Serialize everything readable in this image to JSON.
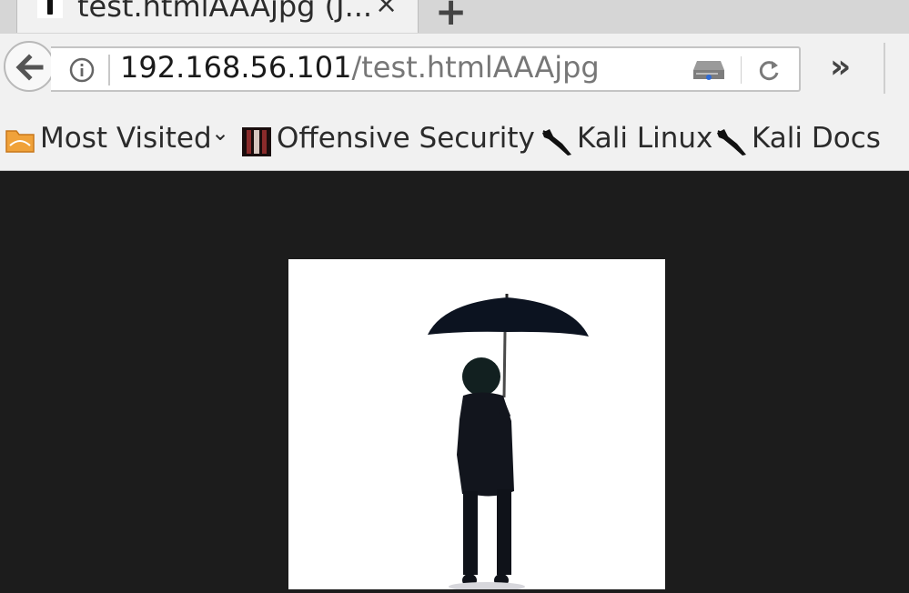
{
  "tab": {
    "title": "test.htmlAAAjpg (J...",
    "close_label": "×",
    "new_tab_label": "+"
  },
  "toolbar": {
    "url_host": "192.168.56.101",
    "url_path": "/test.htmlAAAjpg",
    "overflow_label": "»"
  },
  "bookmarks": [
    {
      "label": "Most Visited",
      "icon": "folder-icon",
      "dropdown": "⌄"
    },
    {
      "label": "Offensive Security",
      "icon": "offsec-icon"
    },
    {
      "label": "Kali Linux",
      "icon": "kali-dragon-icon"
    },
    {
      "label": "Kali Docs",
      "icon": "kali-dragon-icon"
    }
  ],
  "colors": {
    "page_background": "#1c1c1c",
    "chrome_background": "#f1f1f1",
    "tab_strip": "#d6d6d6"
  }
}
